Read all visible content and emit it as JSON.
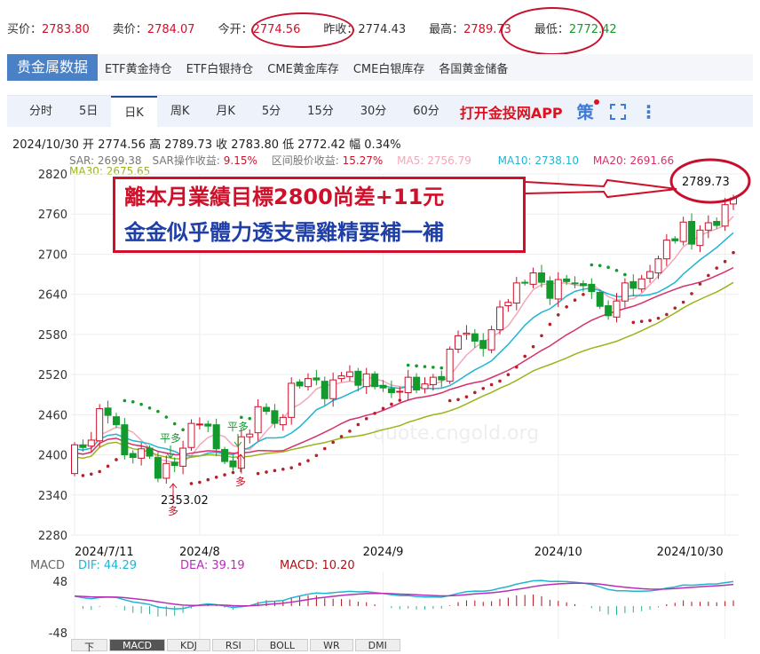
{
  "quote": {
    "bid_label": "买价：",
    "bid": "2783.80",
    "ask_label": "卖价：",
    "ask": "2784.07",
    "open_label": "今开：",
    "open": "2774.56",
    "prev_label": "昨收：",
    "prev": "2774.43",
    "high_label": "最高：",
    "high": "2789.73",
    "low_label": "最低：",
    "low": "2772.42"
  },
  "nav1": {
    "active": "贵金属数据",
    "items": [
      "ETF黄金持仓",
      "ETF白银持仓",
      "CME黄金库存",
      "CME白银库存",
      "各国黄金储备"
    ]
  },
  "nav2": {
    "items": [
      "分时",
      "5日",
      "日K",
      "周K",
      "月K",
      "5分",
      "15分",
      "30分",
      "60分"
    ],
    "active": 2,
    "app": "打开金投网APP",
    "ce": "策"
  },
  "ohlc": "2024/10/30 开 2774.56 高 2789.73 收 2783.80 低 2772.42 幅 0.34%",
  "indicators": {
    "sar": "SAR: 2699.38",
    "sar_ret_label": "SAR操作收益: ",
    "sar_ret": "9.15%",
    "range_label": "区间股价收益: ",
    "range": "15.27%",
    "ma5": "MA5: 2756.79",
    "ma10": "MA10: 2738.10",
    "ma20": "MA20: 2691.66",
    "ma30": "MA30: 2675.65"
  },
  "annotation": {
    "line1": "離本月業績目標2800尚差+11元",
    "line2": "金金似乎體力透支需雞精要補一補",
    "high_label": "2789.73",
    "low_label": "2353.02",
    "ping_duo": "平多",
    "duo": "多"
  },
  "macd": {
    "label": "MACD",
    "dif": "DIF: 44.29",
    "dea": "DEA: 39.19",
    "macd": "MACD: 10.20",
    "ytop": "48",
    "ybot": "-48"
  },
  "bottom_tabs": [
    "下",
    "MACD",
    "KDJ",
    "RSI",
    "BOLL",
    "WR",
    "DMI"
  ],
  "watermark": "quote.cngold.org",
  "colors": {
    "up": "#d0102a",
    "down": "#129a2c",
    "ma5": "#f4a7b9",
    "ma10": "#20b5d0",
    "ma20": "#d6306a",
    "ma30": "#9ab51a",
    "sar": "#129a2c"
  },
  "chart_data": {
    "type": "candlestick",
    "ylim": [
      2280,
      2820
    ],
    "yticks": [
      "2820",
      "2760",
      "2700",
      "2640",
      "2580",
      "2520",
      "2460",
      "2400",
      "2340",
      "2280"
    ],
    "xticks": [
      "2024/7/11",
      "2024/8",
      "2024/9",
      "2024/10",
      "2024/10/30"
    ],
    "xtick_index": [
      0,
      15,
      37,
      58,
      78
    ],
    "close": [
      2415,
      2411,
      2422,
      2469,
      2459,
      2445,
      2400,
      2396,
      2409,
      2398,
      2365,
      2387,
      2384,
      2410,
      2447,
      2446,
      2443,
      2409,
      2390,
      2382,
      2427,
      2431,
      2472,
      2465,
      2447,
      2456,
      2507,
      2503,
      2514,
      2512,
      2484,
      2512,
      2518,
      2524,
      2504,
      2521,
      2502,
      2500,
      2493,
      2495,
      2516,
      2497,
      2506,
      2516,
      2512,
      2558,
      2578,
      2582,
      2570,
      2559,
      2587,
      2621,
      2628,
      2657,
      2657,
      2672,
      2658,
      2634,
      2662,
      2659,
      2656,
      2653,
      2644,
      2622,
      2608,
      2630,
      2657,
      2649,
      2663,
      2674,
      2693,
      2721,
      2720,
      2748,
      2715,
      2736,
      2747,
      2743,
      2774,
      2784
    ],
    "first_open": 2372
  }
}
